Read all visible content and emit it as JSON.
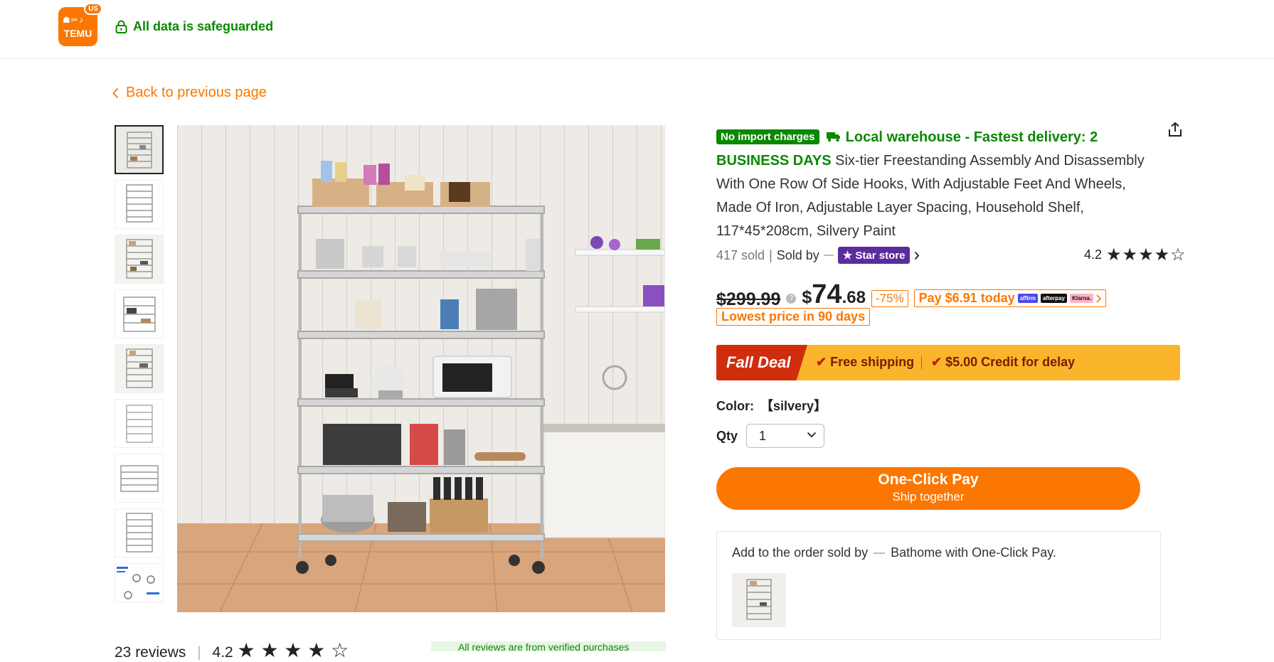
{
  "header": {
    "logo_text": "TEMU",
    "region_badge": "US",
    "safe_text": "All data is safeguarded"
  },
  "nav": {
    "back_label": "Back to previous page"
  },
  "product": {
    "import_badge": "No import charges",
    "shipping_text": "Local warehouse - Fastest delivery: 2 BUSINESS DAYS",
    "title": "Six-tier Freestanding Assembly And Disassembly With One Row Of Side Hooks, With Adjustable Feet And Wheels, Made Of Iron, Adjustable Layer Spacing, Household Shelf, 117*45*208cm, Silvery Paint",
    "sold_count": "417 sold",
    "sold_sep": "|",
    "sold_by": "Sold by",
    "store_badge": "Star store",
    "rating": "4.2",
    "rating_stars": "★★★★☆",
    "old_price": "$299.99",
    "price_symbol": "$",
    "price_int": "74",
    "price_cents": ".68",
    "discount": "-75%",
    "pay_today": "Pay $6.91 today",
    "pay_providers": [
      "affirm",
      "afterpay",
      "Klarna."
    ],
    "lowest_badge": "Lowest price in 90 days",
    "deal_title": "Fall Deal",
    "perk1": "Free shipping",
    "perk2": "$5.00 Credit for delay",
    "color_label": "Color:",
    "color_value": "【silvery】",
    "qty_label": "Qty",
    "qty_value": "1",
    "buy_line1": "One-Click Pay",
    "buy_line2": "Ship together",
    "add_prefix": "Add to the order sold by",
    "add_suffix": "Bathome with One-Click Pay."
  },
  "reviews": {
    "count_text": "23 reviews",
    "sep": "|",
    "rating": "4.2",
    "stars": "★ ★ ★ ★ ☆",
    "verified_text": "All reviews are from verified purchases"
  },
  "colors": {
    "brand_orange": "#fb7701",
    "trust_green": "#0a8800",
    "deal_red": "#d02d0c",
    "deal_yellow": "#fbb52c"
  }
}
